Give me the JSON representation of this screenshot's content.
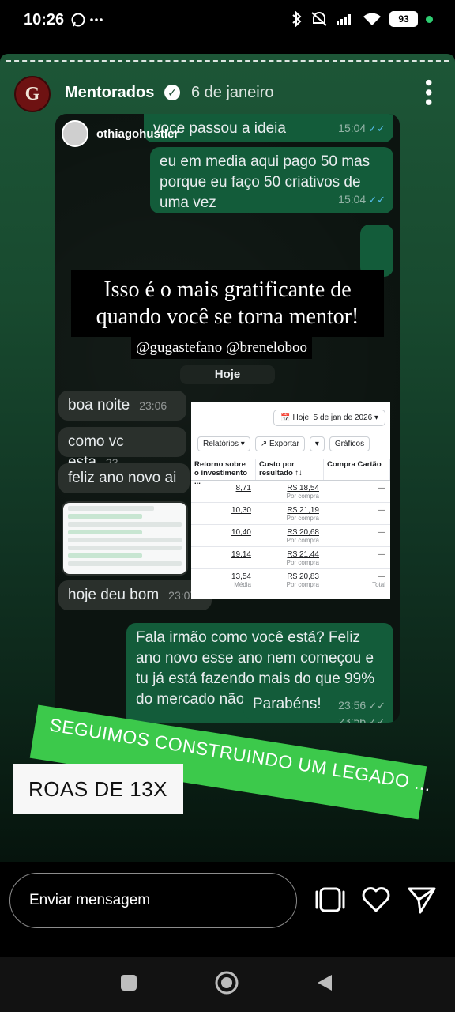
{
  "status_bar": {
    "time": "10:26",
    "left_icons": "ⓦ ···",
    "battery": "93",
    "icons": [
      "bluetooth-icon",
      "mute-icon",
      "signal-icon",
      "wifi-icon",
      "battery-icon"
    ]
  },
  "story": {
    "account": "Mentorados",
    "avatar_letter": "G",
    "date": "6 de janeiro",
    "tagged_user": "othiagohustler"
  },
  "chat": {
    "msg1": "voce passou a ideia",
    "msg1_time": "15:04",
    "msg2": "eu em media aqui pago 50 mas porque eu faço 50 criativos de uma vez",
    "msg2_time": "15:04",
    "day_label": "Hoje",
    "in1": "boa noite",
    "in1_time": "23:06",
    "in2": "como vc esta",
    "in2_time": "23",
    "in3": "feliz ano novo ai",
    "in4": "hoje deu bom",
    "in4_time": "23:07",
    "out3": "Fala irmão como você está? Feliz ano novo esse ano nem começou e tu já está fazendo mais do que 99% do mercado não consegue fazer",
    "out3_time": "23:56",
    "out4": "Parabéns!",
    "out4_time": "23:56"
  },
  "caption": {
    "text": "Isso é o mais gratificante de quando você se torna mentor!",
    "mention1": "@gugastefano",
    "mention2": "@breneloboo"
  },
  "ads": {
    "date_button": "Hoje: 5 de jan de 2026",
    "reports": "Relatórios",
    "export": "Exportar",
    "charts": "Gráficos",
    "col1": "Retorno sobre o investimento ...",
    "col2": "Custo por resultado ↑↓",
    "col3": "Compra Cartão",
    "rows": [
      {
        "roas": "8,71",
        "cost": "R$ 18,54",
        "sub": "Por compra",
        "card": "—"
      },
      {
        "roas": "10,30",
        "cost": "R$ 21,19",
        "sub": "Por compra",
        "card": "—"
      },
      {
        "roas": "10,40",
        "cost": "R$ 20,68",
        "sub": "Por compra",
        "card": "—"
      },
      {
        "roas": "19,14",
        "cost": "R$ 21,44",
        "sub": "Por compra",
        "card": "—"
      },
      {
        "roas": "13,54",
        "cost": "R$ 20,83",
        "sub": "Por compra",
        "card": "—"
      }
    ],
    "footer_roas": "Média",
    "footer_total": "Total"
  },
  "stickers": {
    "banner": "SEGUIMOS CONSTRUINDO UM LEGADO ...",
    "roas": "ROAS DE 13X"
  },
  "bottom": {
    "message_placeholder": "Enviar mensagem"
  }
}
